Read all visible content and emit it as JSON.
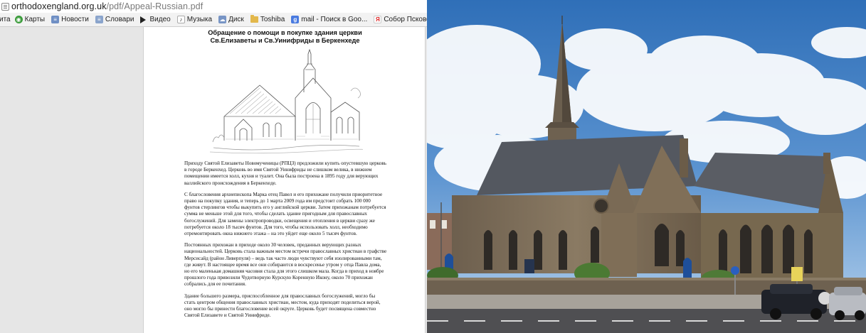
{
  "browser": {
    "url_domain": "orthodoxengland.org.uk",
    "url_path": "/pdf/Appeal-Russian.pdf",
    "bookmarks": [
      {
        "label": "ита",
        "icon": "none"
      },
      {
        "label": "Карты",
        "icon": "maps-icon"
      },
      {
        "label": "Новости",
        "icon": "news-icon"
      },
      {
        "label": "Словари",
        "icon": "dictionary-icon"
      },
      {
        "label": "Видео",
        "icon": "video-play-icon"
      },
      {
        "label": "Музыка",
        "icon": "music-note-icon"
      },
      {
        "label": "Диск",
        "icon": "disk-icon"
      },
      {
        "label": "Toshiba",
        "icon": "folder-icon"
      },
      {
        "label": "mail - Поиск в Goo...",
        "icon": "google-icon"
      },
      {
        "label": "Собор Псково-Печ...",
        "icon": "yandex-icon"
      }
    ]
  },
  "pdf": {
    "title_line1": "Обращение о помощи в покупке здания церкви",
    "title_line2": "Св.Елизаветы и Св.Уинифриды в Беркенхеде",
    "paragraphs": [
      "Приходу Святой Елизаветы Новомученицы (РПЦЗ) предложили купить опустевшую церковь в городе Беркенхед. Церковь во имя Святой Уинифриды не слишком велика, в нижнем помещении имеется холл, кухня и туалет. Она была построена в 1895 году для верующих валлийского происхождения в Беркенхеде.",
      "С благословения архиепископа Марка отец Павел и его прихожане получили приоритетное право на покупку здания, и теперь до 1 марта 2009 года им предстоит собрать 100 000 фунтов стерлингов чтобы выкупить его у английской церкви. Затем прихожанам потребуется сумма не меньше этой для того, чтобы сделать здание пригодным для православных богослужений. Для замены электропроводки, освещения и отопления в церкви сразу же потребуется около 18 тысяч фунтов. Для того, чтобы использовать холл, необходимо отремонтировать окна нижнего этажа – на это уйдет еще около 5 тысяч фунтов.",
      "Постоянных прихожан в приходе около 30 человек, преданных верующих разных национальностей. Церковь стала важным местом встречи православных христиан в графстве Мерсисайд (район Ливерпуля) – ведь так часто люди чувствуют себя изолированными там, где живут. В настоящее время все они собираются в воскресенье утром у отца Павла дома, но его маленькая домашняя часовня стала для этого слишком мала. Когда в приход в ноябре прошлого года привозили Чудотворную Курскую Коренную Икону, около 70 прихожан собрались для ее почитания.",
      "Здание большего размера, приспособленное для православных богослужений, могло бы стать центром общения православных христиан, местом, куда приходят поделиться верой, оно могло бы принести благословение всей округе. Церковь будет посвящена совместно Святой Елизавете и Святой Уинифриде."
    ]
  },
  "colors": {
    "sky": "#3f7fc4",
    "stone": "#7a6a55",
    "roof": "#55585e",
    "grass": "#4e7a36"
  }
}
